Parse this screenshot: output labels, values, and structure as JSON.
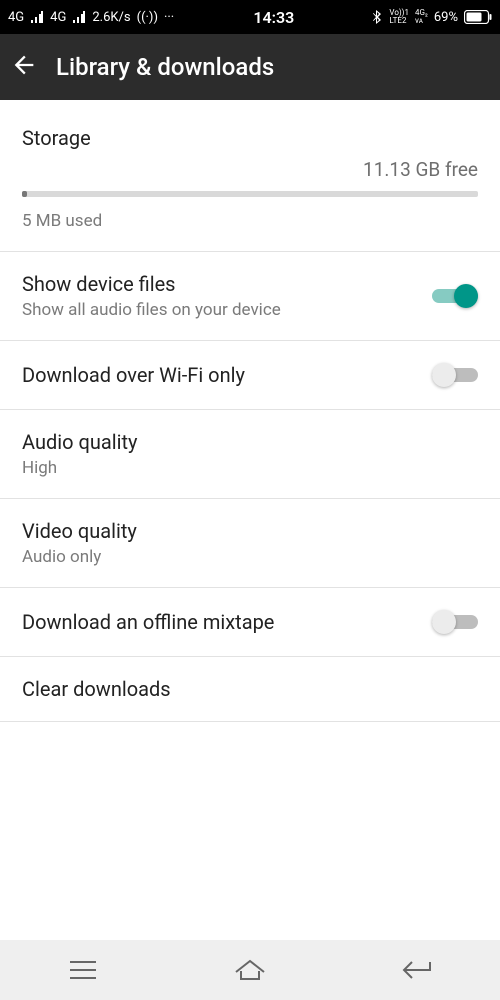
{
  "status": {
    "net1": "4G",
    "net2": "4G",
    "speed": "2.6K/s",
    "time": "14:33",
    "volte": "Vo))1",
    "lte": "LTE2",
    "sim2_4g": "4G₂",
    "small_va": "vᴀ",
    "battery": "69%"
  },
  "header": {
    "title": "Library & downloads"
  },
  "storage": {
    "title": "Storage",
    "free": "11.13 GB free",
    "used": "5 MB used"
  },
  "settings": {
    "show_device_files": {
      "title": "Show device files",
      "sub": "Show all audio files on your device",
      "on": true
    },
    "wifi_only": {
      "title": "Download over Wi-Fi only",
      "on": false
    },
    "audio_quality": {
      "title": "Audio quality",
      "sub": "High"
    },
    "video_quality": {
      "title": "Video quality",
      "sub": "Audio only"
    },
    "offline_mixtape": {
      "title": "Download an offline mixtape",
      "on": false
    },
    "clear": {
      "title": "Clear downloads"
    }
  }
}
